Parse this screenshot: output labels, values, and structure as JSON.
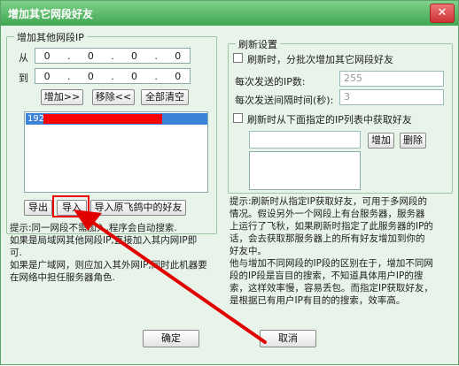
{
  "window": {
    "title": "增加其它网段好友",
    "close_glyph": "✕"
  },
  "left_group": {
    "legend": "增加其他网段IP",
    "from_label": "从",
    "to_label": "到",
    "from_ip": [
      "0",
      "0",
      "0",
      "0"
    ],
    "to_ip": [
      "0",
      "0",
      "0",
      "0"
    ],
    "ip_dot": ".",
    "add_label": "增加>>",
    "remove_label": "移除<<",
    "clear_label": "全部清空",
    "list_item_prefix": "192.",
    "export_label": "导出",
    "import_label": "导入",
    "import_friends_label": "导入原飞鸽中的好友",
    "info_lines": [
      "提示:同一网段不需加入,程序会自动搜索.",
      "如果是局域网其他网段IP,直接加入其内网IP即",
      "可.",
      "如果是广域网，则应加入其外网IP,同时此机器要",
      "在网络中担任服务器角色."
    ]
  },
  "right_group": {
    "legend": "刷新设置",
    "refresh_checkbox_label": "刷新时，分批次增加其它网段好友",
    "ip_count_label": "每次发送的IP数:",
    "ip_count_value": "255",
    "interval_label": "每次发送间隔时间(秒):",
    "interval_value": "3",
    "list_refresh_label": "刷新时从下面指定的IP列表中获取好友",
    "add_label": "增加",
    "delete_label": "删除",
    "info_lines": [
      "提示:刷新时从指定IP获取好友，可用于多网段的",
      "情况。假设另外一个网段上有台服务器，服务器",
      "上运行了飞秋，如果刷新时指定了此服务器的IP的",
      "话，会去获取那服务器上的所有好友增加到你的",
      "好友中。",
      "他与增加不同网段的IP段的区别在于，增加不同网",
      "段的IP段是盲目的搜索，不知道具体用户IP的搜",
      "索，这样效率慢，容易丢包。而指定IP获取好友，",
      "是根据已有用户IP有目的的搜索，效率高。"
    ]
  },
  "footer": {
    "ok_label": "确定",
    "cancel_label": "取消"
  },
  "colors": {
    "title_bar": "#3fa750",
    "annotation": "#e00000",
    "highlight": "#3b82d9",
    "redaction": "#ff0000"
  }
}
